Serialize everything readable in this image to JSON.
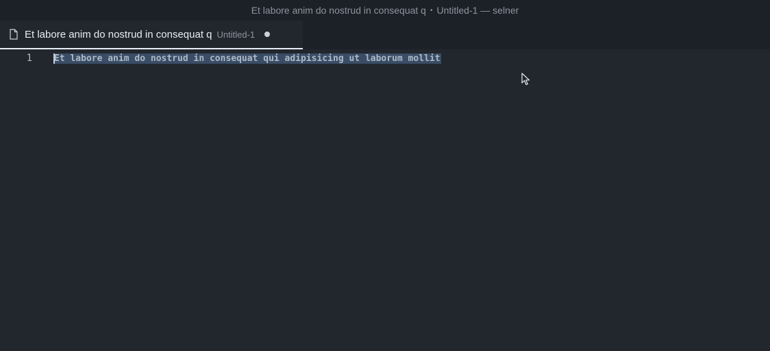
{
  "window": {
    "title_file": "Et labore anim do nostrud in consequat q",
    "title_separator": "•",
    "title_rest": "Untitled-1 — selner"
  },
  "tabs": [
    {
      "label": "Et labore anim do nostrud in consequat q",
      "description": "Untitled-1",
      "dirty": true,
      "icon": "file-icon"
    }
  ],
  "editor": {
    "lines": [
      {
        "number": "1",
        "text": "Et labore anim do nostrud in consequat qui adipisicing ut laborum mollit",
        "selected": true
      }
    ]
  },
  "colors": {
    "background": "#22272e",
    "chrome": "#1c2128",
    "selection": "#3a4d66",
    "text": "#adbac7",
    "muted": "#8b949e"
  }
}
